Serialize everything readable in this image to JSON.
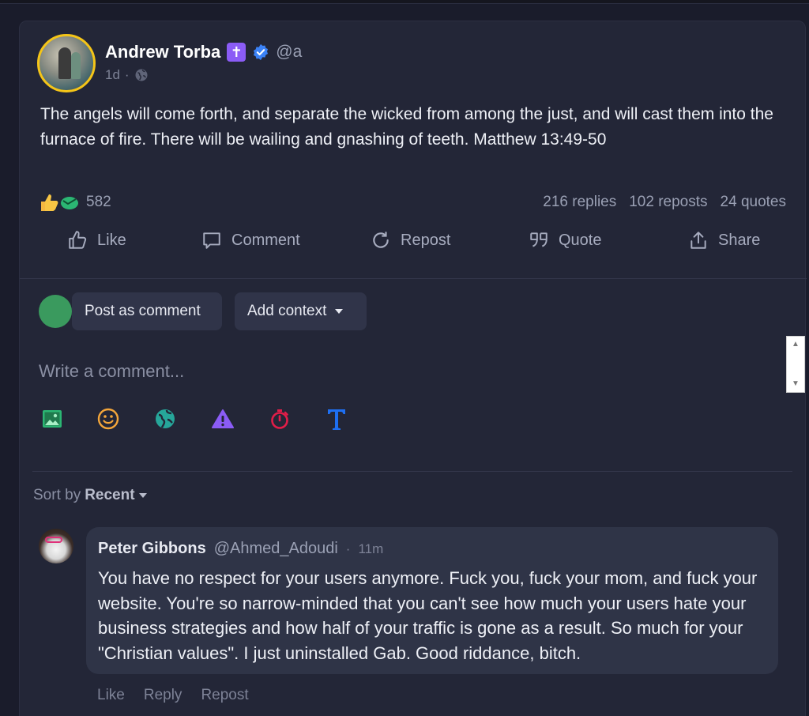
{
  "post": {
    "author_name": "Andrew Torba",
    "author_handle": "@a",
    "cross_badge": "✝",
    "timestamp": "1d",
    "meta_separator": "·",
    "text": "The angels will come forth, and separate the wicked from among the just, and will cast them into the furnace of fire. There will be wailing and gnashing of teeth. Matthew 13:49-50",
    "reactions_count": "582",
    "reaction_icons": [
      "thumbs-up-icon",
      "green-reaction-icon"
    ],
    "replies": "216 replies",
    "reposts": "102 reposts",
    "quotes": "24 quotes"
  },
  "actions": {
    "like": "Like",
    "comment": "Comment",
    "repost": "Repost",
    "quote": "Quote",
    "share": "Share"
  },
  "composer": {
    "post_as_comment": "Post as comment",
    "add_context": "Add context",
    "placeholder": "Write a comment...",
    "tools": [
      "image-icon",
      "emoji-icon",
      "globe-icon",
      "warning-icon",
      "timer-icon",
      "text-format-icon"
    ]
  },
  "sort": {
    "label": "Sort by",
    "value": "Recent"
  },
  "comment": {
    "author_name": "Peter Gibbons",
    "author_handle": "@Ahmed_Adoudi",
    "separator": "·",
    "time": "11m",
    "text": "You have no respect for your users anymore. Fuck you, fuck your mom, and fuck your website. You're so narrow-minded that you can't see how much your users hate your business strategies and how half of your traffic is gone as a result. So much for your \"Christian values\". I just uninstalled Gab. Good riddance, bitch.",
    "like": "Like",
    "reply": "Reply",
    "repost": "Repost"
  },
  "colors": {
    "background": "#1a1c2b",
    "card": "#232637",
    "avatar_ring": "#f5c518",
    "verified": "#3b82f6",
    "cross_badge": "#8b5cf6",
    "bubble": "#2f3447"
  }
}
